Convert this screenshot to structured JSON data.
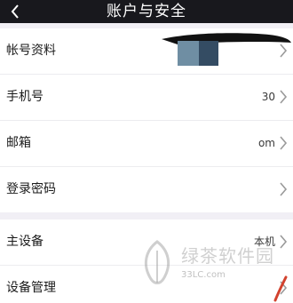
{
  "header": {
    "title": "账户与安全",
    "background": "#18181d"
  },
  "groups": [
    {
      "items": [
        {
          "label": "帐号资料",
          "value": ""
        },
        {
          "label": "手机号",
          "value": "30"
        },
        {
          "label": "邮箱",
          "value": "om"
        },
        {
          "label": "登录密码",
          "value": ""
        }
      ]
    },
    {
      "items": [
        {
          "label": "主设备",
          "value": "本机"
        },
        {
          "label": "设备管理",
          "value": ""
        }
      ]
    }
  ],
  "watermark": {
    "text": "绿茶软件园",
    "url": "33LC.com"
  },
  "icons": {
    "back": "chevron-left-icon",
    "row_arrow": "chevron-right-icon"
  },
  "colors": {
    "page_background": "#f1eff5",
    "row_background": "#ffffff",
    "redaction_light": "#6f8ea3",
    "redaction_dark": "#344c63"
  }
}
